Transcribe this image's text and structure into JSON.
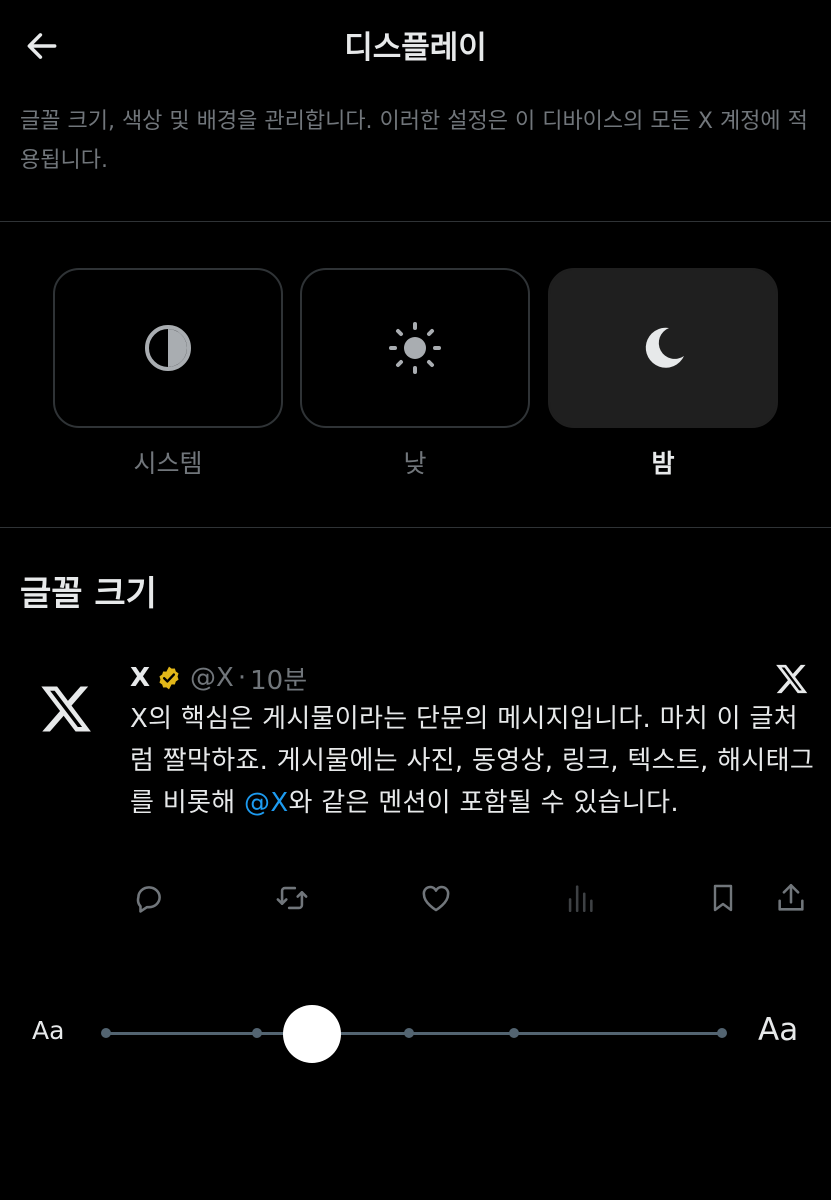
{
  "header": {
    "title": "디스플레이",
    "back_icon": "arrow-left-icon"
  },
  "description": "글꼴 크기, 색상 및 배경을 관리합니다. 이러한 설정은 이 디바이스의 모든 X 계정에 적용됩니다.",
  "theme": {
    "options": [
      {
        "label": "시스템",
        "icon": "half-circle-icon",
        "selected": false
      },
      {
        "label": "낮",
        "icon": "sun-icon",
        "selected": false
      },
      {
        "label": "밤",
        "icon": "moon-icon",
        "selected": true
      }
    ]
  },
  "font_size": {
    "title": "글꼴 크기",
    "slider": {
      "min_label": "Aa",
      "max_label": "Aa",
      "steps": 5,
      "selected_step": 2
    }
  },
  "post": {
    "author": "X",
    "handle": "@X",
    "separator": "·",
    "time": "10분",
    "text_before_mention": "X의 핵심은 게시물이라는 단문의 메시지입니다. 마치 이 글처럼 짤막하죠. 게시물에는 사진, 동영상, 링크, 텍스트, 해시태그를 비롯해 ",
    "mention": "@X",
    "text_after_mention": "와 같은 멘션이 포함될 수 있습니다.",
    "actions": [
      "reply-icon",
      "repost-icon",
      "like-icon",
      "views-icon",
      "bookmark-icon",
      "share-icon"
    ]
  },
  "colors": {
    "background": "#000000",
    "text_primary": "#e7e9ea",
    "text_secondary": "#71767b",
    "divider": "#2f3336",
    "accent": "#1d9bf0",
    "verified_gold": "#e2b719",
    "selected_card": "#1f1f1f"
  }
}
